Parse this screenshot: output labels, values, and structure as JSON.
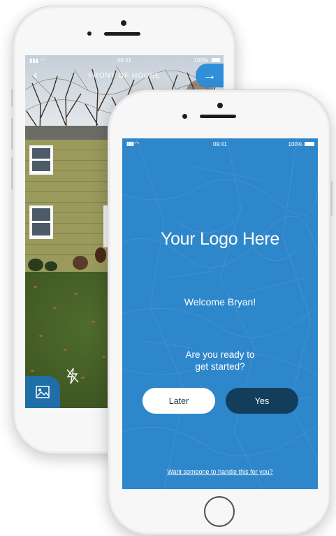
{
  "back_phone": {
    "status": {
      "time": "09:41",
      "battery": "100%"
    },
    "screen_title": "FRONT OF HOUSE"
  },
  "front_phone": {
    "status": {
      "time": "09:41",
      "battery": "100%"
    },
    "logo_text": "Your Logo Here",
    "welcome_text": "Welcome Bryan!",
    "question_line1": "Are you ready to",
    "question_line2": "get started?",
    "later_label": "Later",
    "yes_label": "Yes",
    "help_link": "Want someone to handle this for you?"
  },
  "colors": {
    "screen_blue": "#2f87cb",
    "yes_button": "#123e5c",
    "later_button": "#ffffff",
    "accent_blue": "#2f8fd8"
  },
  "icons": {
    "back": "chevron-left-icon",
    "next": "arrow-right-icon",
    "gallery": "image-icon",
    "flash": "flash-off-icon"
  }
}
